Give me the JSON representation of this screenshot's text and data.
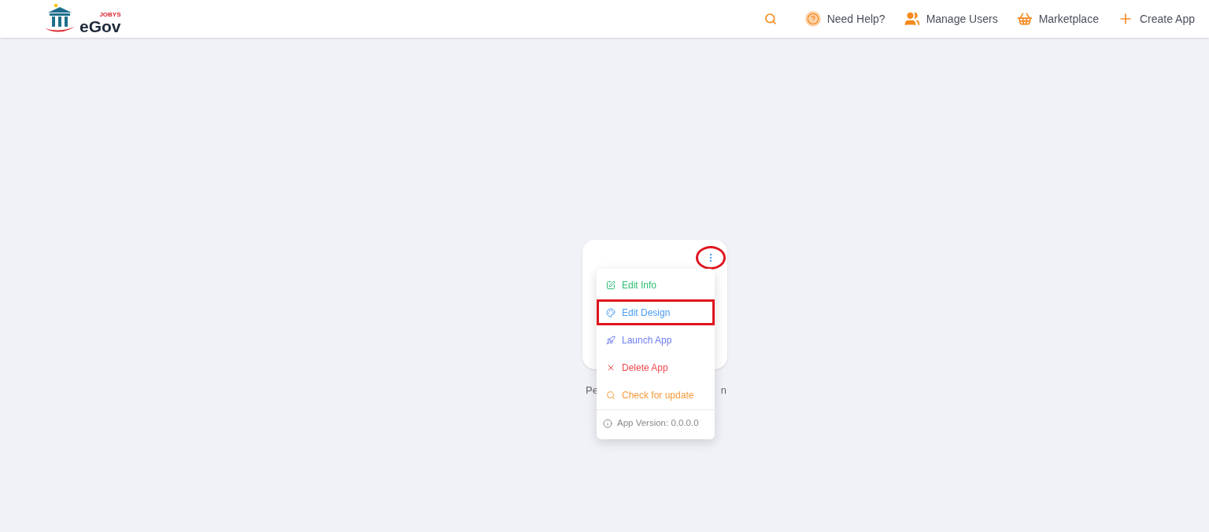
{
  "header": {
    "logo": {
      "tag": "JOBYS",
      "text": "eGov"
    },
    "nav": [
      {
        "kind": "search"
      },
      {
        "kind": "help",
        "label": "Need Help?"
      },
      {
        "kind": "users",
        "label": "Manage Users"
      },
      {
        "kind": "basket",
        "label": "Marketplace"
      },
      {
        "kind": "plus",
        "label": "Create App"
      }
    ]
  },
  "app_card": {
    "name_start": "Pe",
    "name_end": "n",
    "menu_button_circled": true,
    "menu": {
      "items": [
        {
          "kind": "edit",
          "label": "Edit Info",
          "color": "#2bbf72",
          "highlighted": false
        },
        {
          "kind": "design",
          "label": "Edit Design",
          "color": "#4a9cf0",
          "highlighted": true
        },
        {
          "kind": "launch",
          "label": "Launch App",
          "color": "#6d7cf2",
          "highlighted": false
        },
        {
          "kind": "delete",
          "label": "Delete App",
          "color": "#f0484e",
          "highlighted": false
        },
        {
          "kind": "update",
          "label": "Check for update",
          "color": "#f59a3a",
          "highlighted": false
        }
      ],
      "version": "App Version: 0.0.0.0"
    }
  }
}
